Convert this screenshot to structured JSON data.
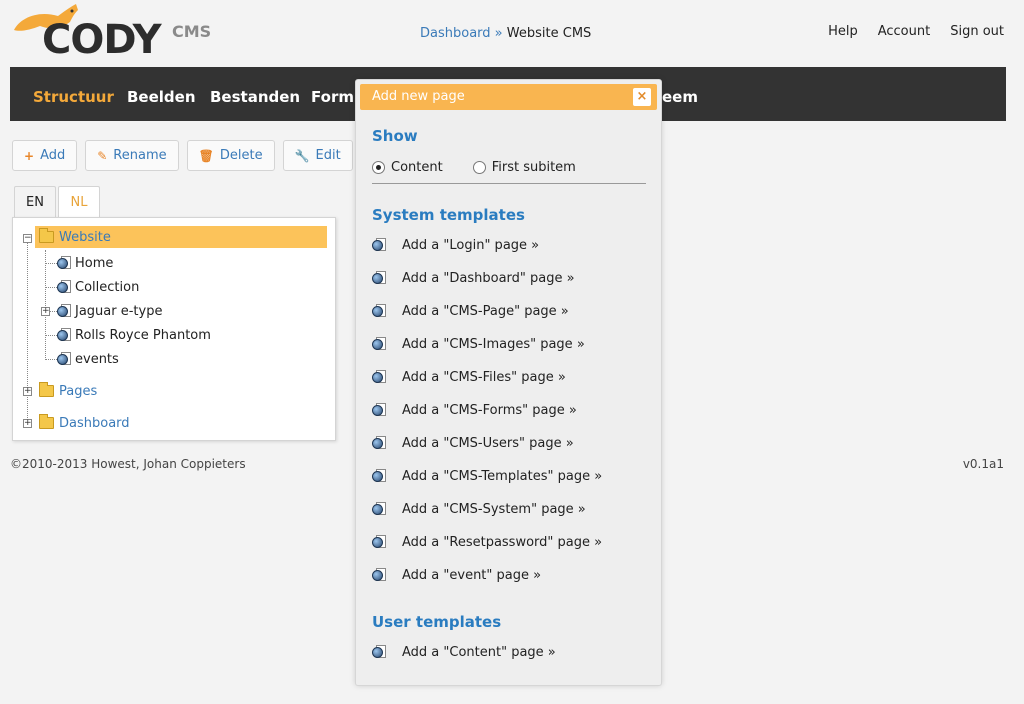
{
  "brand": {
    "name": "CODY",
    "sub": "CMS"
  },
  "breadcrumb": {
    "link": "Dashboard",
    "separator": "»",
    "current": "Website CMS"
  },
  "top_links": [
    "Help",
    "Account",
    "Sign out"
  ],
  "navbar": {
    "items": [
      "Structuur",
      "Beelden",
      "Bestanden",
      "Formu",
      "eem"
    ],
    "active_index": 0
  },
  "toolbar": {
    "add": "Add",
    "rename": "Rename",
    "delete": "Delete",
    "edit": "Edit"
  },
  "lang_tabs": [
    "EN",
    "NL"
  ],
  "active_lang": "NL",
  "tree": {
    "root": "Website",
    "children": [
      "Home",
      "Collection",
      "Jaguar e-type",
      "Rolls Royce Phantom",
      "events"
    ],
    "folders": [
      "Pages",
      "Dashboard"
    ]
  },
  "footer": {
    "copyright": "©2010-2013 Howest, Johan Coppieters",
    "version": "v0.1a1"
  },
  "modal": {
    "title": "Add new page",
    "close": "×",
    "show_title": "Show",
    "show_options": [
      "Content",
      "First subitem"
    ],
    "show_selected": "Content",
    "system_title": "System templates",
    "system_items": [
      "Add a \"Login\" page »",
      "Add a \"Dashboard\" page »",
      "Add a \"CMS-Page\" page »",
      "Add a \"CMS-Images\" page »",
      "Add a \"CMS-Files\" page »",
      "Add a \"CMS-Forms\" page »",
      "Add a \"CMS-Users\" page »",
      "Add a \"CMS-Templates\" page »",
      "Add a \"CMS-System\" page »",
      "Add a \"Resetpassword\" page »",
      "Add a \"event\" page »"
    ],
    "user_title": "User templates",
    "user_items": [
      "Add a \"Content\" page »"
    ]
  },
  "colors": {
    "accent": "#f4a93a",
    "link": "#3a7ab8",
    "nav_bg": "#333333",
    "modal_header": "#f9b550"
  }
}
